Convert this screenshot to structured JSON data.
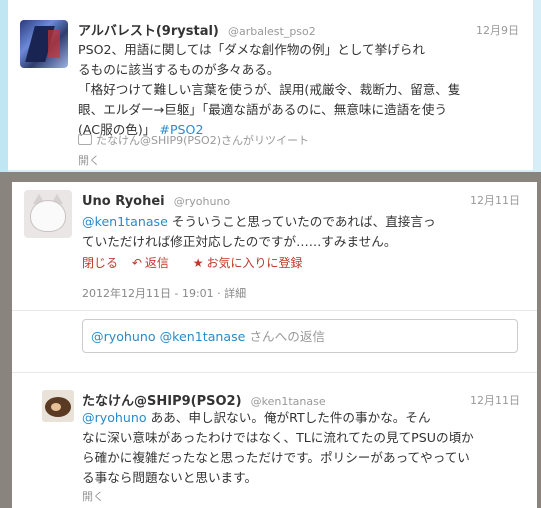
{
  "tweet1": {
    "name": "アルバレスト(9rystal)",
    "handle": "@arbalest_pso2",
    "date": "12月9日",
    "lines": [
      "PSO2、用語に関しては「ダメな創作物の例」として挙げられ",
      "るものに該当するものが多々ある。",
      "「格好つけて難しい言葉を使うが、誤用(戒厳令、裁断力、留意、隻",
      "眼、エルダー→巨躯」「最適な語があるのに、無意味に造語を使う",
      "(AC服の色)」"
    ],
    "hashtag": "#PSO2",
    "retweet_text": "たなけん@SHIP9(PSO2)さんがリツイート",
    "open_label": "開く"
  },
  "tweet2": {
    "name": "Uno Ryohei",
    "handle": "@ryohuno",
    "date": "12月11日",
    "mention": "@ken1tanase",
    "line1_rest": " そういうこと思っていたのであれば、直接言っ",
    "line2": "ていただければ修正対応したのですが……すみません。",
    "actions": {
      "close": "閉じる",
      "reply": "返信",
      "favorite": "お気に入りに登録"
    },
    "timestamp": "2012年12月11日 - 19:01",
    "detail": "詳細"
  },
  "reply_box": {
    "prefill": "@ryohuno @ken1tanase",
    "placeholder_suffix": " さんへの返信"
  },
  "tweet3": {
    "name": "たなけん@SHIP9(PSO2)",
    "handle": "@ken1tanase",
    "date": "12月11日",
    "mention": "@ryohuno",
    "line1_rest": " ああ、申し訳ない。俺がRTした件の事かな。そん",
    "lines": [
      "なに深い意味があったわけではなく、TLに流れてたの見てPSUの頃か",
      "ら確かに複雑だったなと思っただけです。ポリシーがあってやってい",
      "る事なら問題ないと思います。"
    ],
    "open_label": "開く"
  }
}
